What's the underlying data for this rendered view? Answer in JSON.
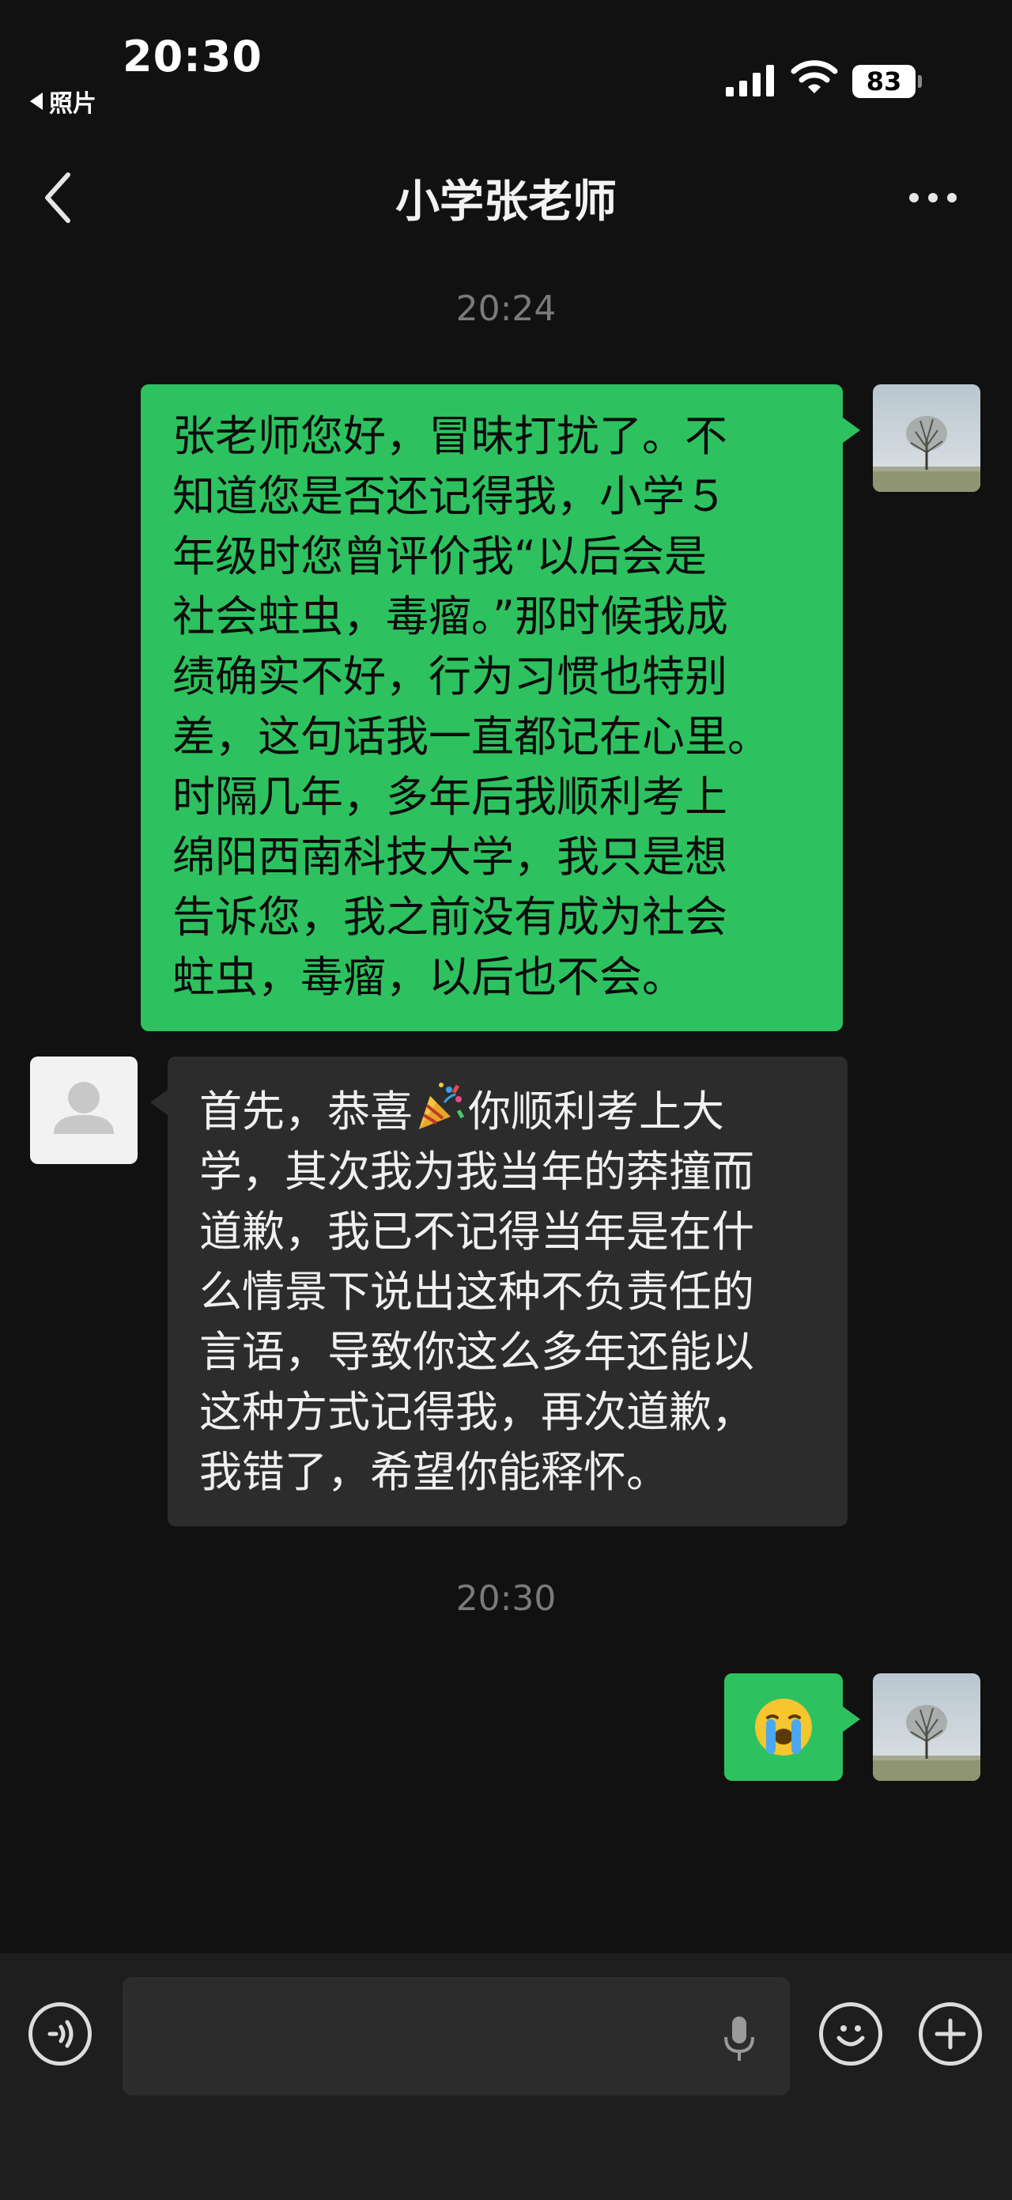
{
  "status_bar": {
    "time": "20:30",
    "back_app_label": "照片",
    "battery": "83"
  },
  "nav": {
    "title": "小学张老师"
  },
  "messages": {
    "timestamp_1": "20:24",
    "timestamp_2": "20:30",
    "sent_1": [
      "张老师您好，冒昧打扰了。不",
      "知道您是否还记得我，小学５",
      "年级时您曾评价我“以后会是",
      "社会蛀虫，毒瘤。”那时候我成",
      "绩确实不好，行为习惯也特别",
      "差，这句话我一直都记在心里。",
      "时隔几年，多年后我顺利考上",
      "绵阳西南科技大学，我只是想",
      "告诉您，我之前没有成为社会",
      "蛀虫，毒瘤，以后也不会。"
    ],
    "received_1": {
      "line1_before": "首先，恭喜",
      "line1_after": "你顺利考上大",
      "lines": [
        "学，其次我为我当年的莽撞而",
        "道歉，我已不记得当年是在什",
        "么情景下说出这种不负责任的",
        "言语，导致你这么多年还能以",
        "这种方式记得我，再次道歉，",
        "我错了，希望你能释怀。"
      ]
    },
    "sent_2_emoji": "loudly-crying-face"
  },
  "icons": {
    "inline_emoji": "party-popper",
    "accent_green": "#2dc25f",
    "bubble_gray": "#2c2c2c"
  }
}
